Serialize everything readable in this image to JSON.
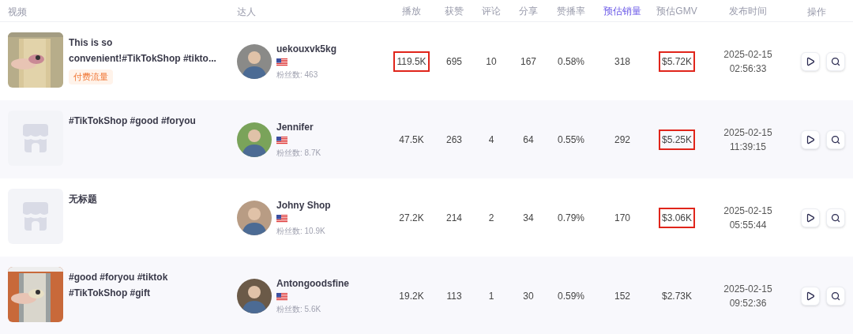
{
  "columns": [
    {
      "label": "视频",
      "selected": false
    },
    {
      "label": "达人",
      "selected": false
    },
    {
      "label": "播放",
      "selected": false
    },
    {
      "label": "获赞",
      "selected": false
    },
    {
      "label": "评论",
      "selected": false
    },
    {
      "label": "分享",
      "selected": false
    },
    {
      "label": "赞播率",
      "selected": false
    },
    {
      "label": "预估销量",
      "selected": true
    },
    {
      "label": "预估GMV",
      "selected": false
    },
    {
      "label": "发布时间",
      "selected": false
    },
    {
      "label": "操作",
      "selected": false
    }
  ],
  "rows": [
    {
      "title": "This is so convenient!#TikTokShop #tikto...",
      "tag": "付费流量",
      "creator": "uekouxvk5kg",
      "followers": "粉丝数: 463",
      "plays": "119.5K",
      "plays_highlighted": true,
      "likes": "695",
      "comments": "10",
      "shares": "167",
      "like_rate": "0.58%",
      "est_sales": "318",
      "est_gmv": "$5.72K",
      "gmv_highlighted": true,
      "date": "2025-02-15",
      "time": "02:56:33"
    },
    {
      "thumbnail": {
        "kind": "placeholder"
      },
      "title": "#TikTokShop #good #foryou",
      "creator": "Jennifer",
      "followers": "粉丝数: 8.7K",
      "plays": "47.5K",
      "plays_highlighted": false,
      "likes": "263",
      "comments": "4",
      "shares": "64",
      "like_rate": "0.55%",
      "est_sales": "292",
      "est_gmv": "$5.25K",
      "gmv_highlighted": true,
      "date": "2025-02-15",
      "time": "11:39:15"
    },
    {
      "thumbnail": {
        "kind": "placeholder"
      },
      "title": "无标题",
      "creator": "Johny Shop",
      "followers": "粉丝数: 10.9K",
      "plays": "27.2K",
      "plays_highlighted": false,
      "likes": "214",
      "comments": "2",
      "shares": "34",
      "like_rate": "0.79%",
      "est_sales": "170",
      "est_gmv": "$3.06K",
      "gmv_highlighted": true,
      "date": "2025-02-15",
      "time": "05:55:44"
    },
    {
      "title": "#good #foryou #tiktok #TikTokShop #gift",
      "creator": "Antongoodsfine",
      "followers": "粉丝数: 5.6K",
      "plays": "19.2K",
      "plays_highlighted": false,
      "likes": "113",
      "comments": "1",
      "shares": "30",
      "like_rate": "0.59%",
      "est_sales": "152",
      "est_gmv": "$2.73K",
      "gmv_highlighted": false,
      "date": "2025-02-15",
      "time": "09:52:36"
    }
  ]
}
